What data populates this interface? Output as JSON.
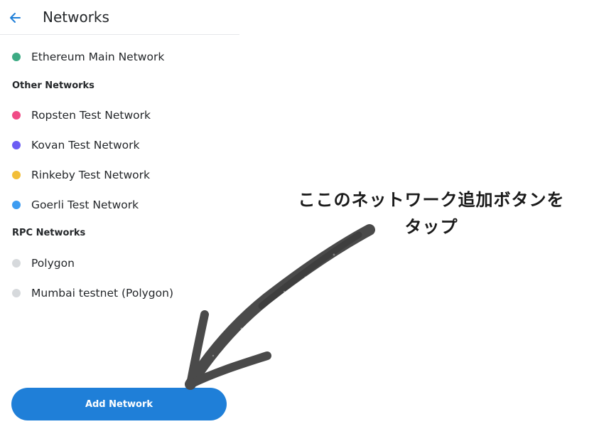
{
  "header": {
    "title": "Networks",
    "back_icon": "arrow-left-icon"
  },
  "main_network": {
    "label": "Ethereum Main Network",
    "color": "#3dab84"
  },
  "other_networks": {
    "heading": "Other Networks",
    "items": [
      {
        "label": "Ropsten Test Network",
        "color": "#f04a86"
      },
      {
        "label": "Kovan Test Network",
        "color": "#6c5cf4"
      },
      {
        "label": "Rinkeby Test Network",
        "color": "#f2be38"
      },
      {
        "label": "Goerli Test Network",
        "color": "#3d9cf1"
      }
    ]
  },
  "rpc_networks": {
    "heading": "RPC Networks",
    "items": [
      {
        "label": "Polygon",
        "color": "#d6d9dc"
      },
      {
        "label": "Mumbai testnet (Polygon)",
        "color": "#d6d9dc"
      }
    ]
  },
  "add_button": {
    "label": "Add Network",
    "color": "#1f7fd8"
  },
  "annotation": {
    "line1": "ここのネットワーク追加ボタンを",
    "line2": "タップ"
  }
}
